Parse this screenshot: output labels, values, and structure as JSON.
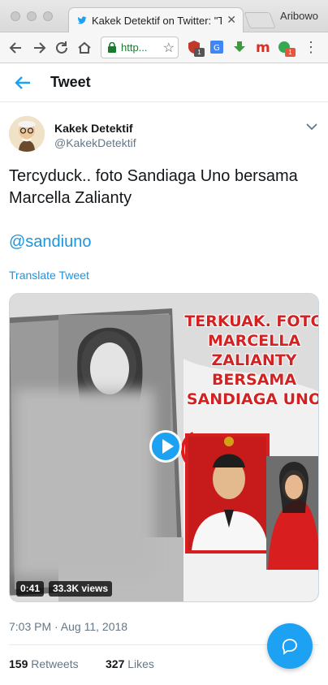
{
  "browser": {
    "tab_title": "Kakek Detektif on Twitter: \"Tercyduck..",
    "profile_name": "Aribowo",
    "url": "http...",
    "extension_badges": [
      "1",
      "1"
    ]
  },
  "header": {
    "title": "Tweet"
  },
  "tweet": {
    "author_name": "Kakek Detektif",
    "author_handle": "@KakekDetektif",
    "text": "Tercyduck.. foto Sandiaga Uno bersama Marcella Zalianty",
    "mention": "@sandiuno",
    "translate_label": "Translate Tweet",
    "timestamp": "7:03 PM · Aug 11, 2018",
    "video": {
      "duration": "0:41",
      "views": "33.3K views",
      "headline_lines": [
        "TERKUAK. FOTO",
        "MARCELLA",
        "ZALIANTY",
        "BERSAMA",
        "SANDIAGA UNO"
      ]
    },
    "stats": {
      "retweets_count": "159",
      "retweets_label": "Retweets",
      "likes_count": "327",
      "likes_label": "Likes"
    }
  },
  "colors": {
    "twitter_blue": "#1da1f2",
    "link_blue": "#1b95e0",
    "secondary_text": "#657786",
    "headline_red": "#d42222"
  },
  "icons": {
    "back": "back-arrow-icon",
    "caret": "chevron-down-icon",
    "play": "play-icon",
    "compose": "reply-bubble-icon"
  }
}
